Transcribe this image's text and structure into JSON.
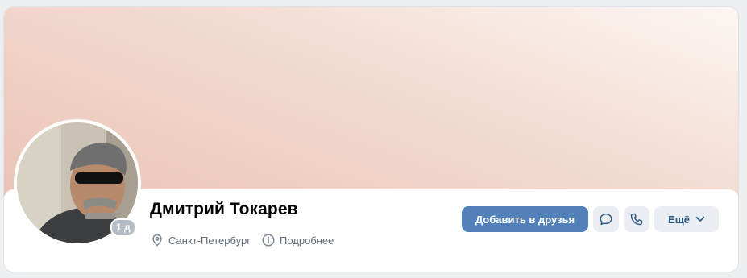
{
  "profile": {
    "name": "Дмитрий Токарев",
    "last_seen": "1 д",
    "city": "Санкт-Петербург",
    "details_link": "Подробнее"
  },
  "actions": {
    "add_friend": "Добавить в друзья",
    "more": "Ещё"
  },
  "icons": {
    "location": "location-pin-icon",
    "info": "info-circle-icon",
    "message": "message-bubble-icon",
    "call": "phone-icon",
    "dropdown": "chevron-down-icon"
  },
  "colors": {
    "primary_button": "#5181b8",
    "secondary_button": "#eaedf1",
    "link": "#2a5885",
    "muted_text": "#626d7a",
    "badge": "#b4bcc6",
    "cover_gradient_light": "#fcf6f3",
    "cover_gradient_dark": "#eac4b6"
  }
}
